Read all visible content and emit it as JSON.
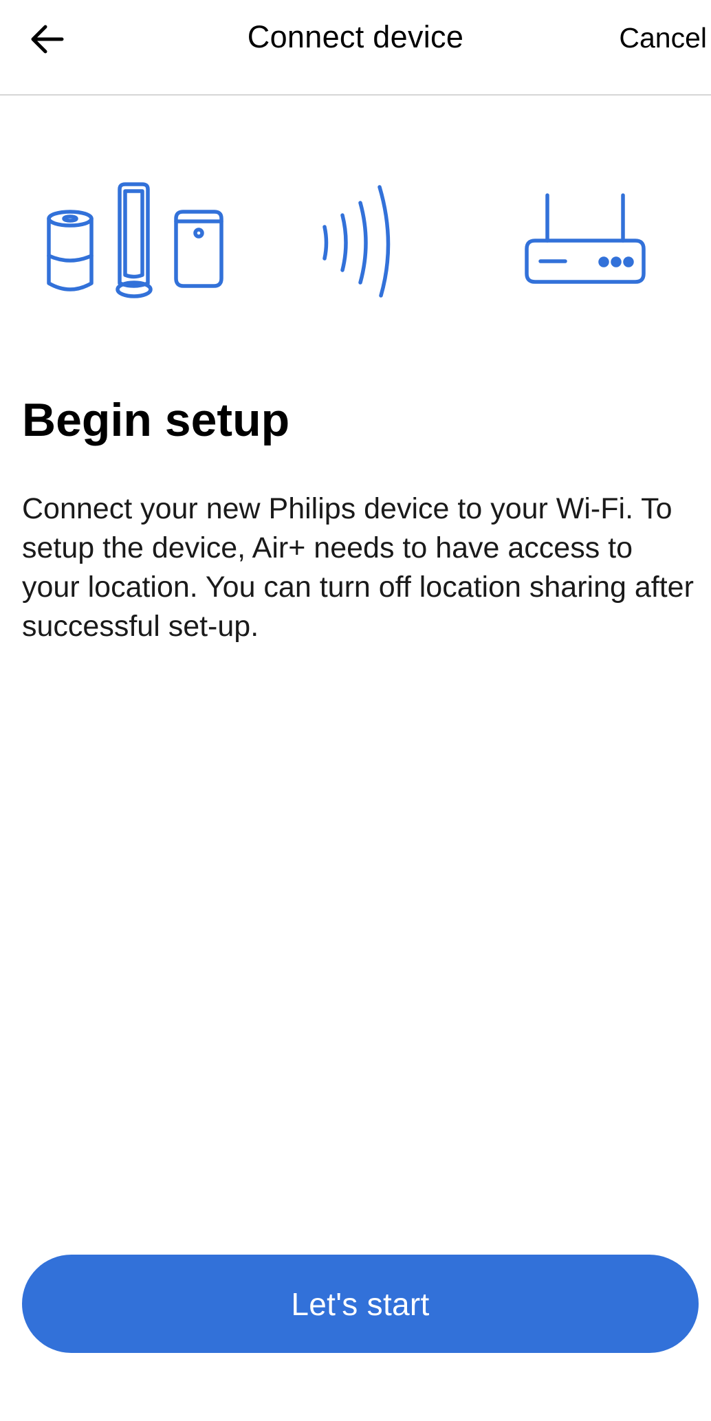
{
  "header": {
    "title": "Connect device",
    "cancel_label": "Cancel",
    "back_icon": "arrow-left-icon"
  },
  "illustration": {
    "icons": [
      "air-purifier-devices-icon",
      "wireless-signal-icon",
      "wifi-router-icon"
    ],
    "accent_color": "#3271d9"
  },
  "main": {
    "title": "Begin setup",
    "description": "Connect your new Philips device to your Wi-Fi. To setup the device, Air+ needs to have access to your location. You can turn off location sharing after successful set-up."
  },
  "footer": {
    "start_label": "Let's start",
    "button_color": "#3271d9"
  }
}
